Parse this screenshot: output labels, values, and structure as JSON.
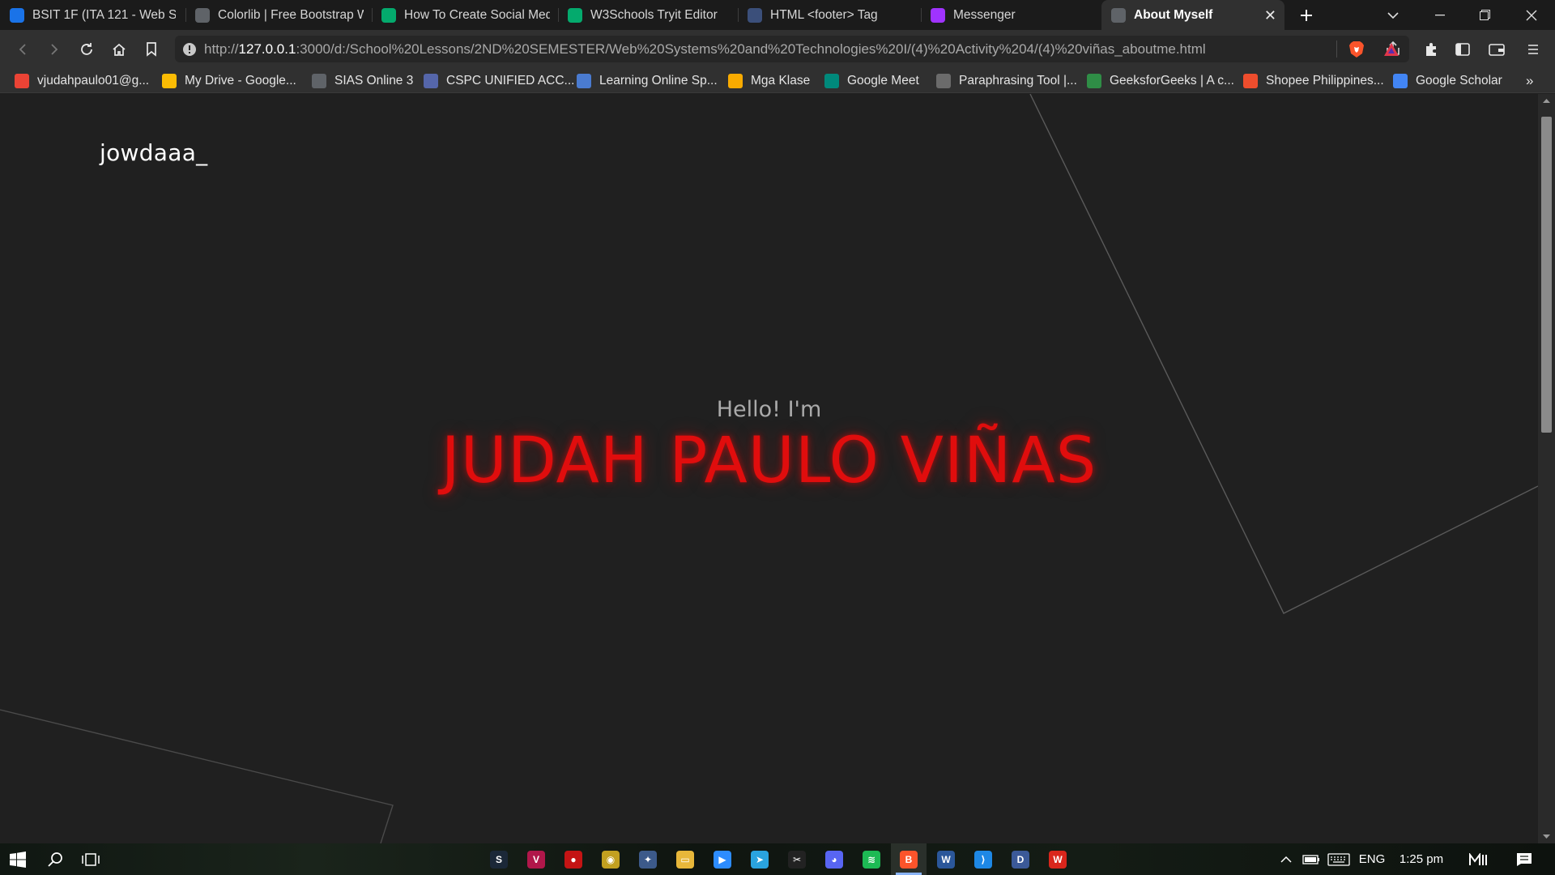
{
  "browser": {
    "tabs": [
      {
        "title": "BSIT 1F (ITA 121 - Web Syst",
        "icon": "classroom-icon",
        "color": "#1a73e8"
      },
      {
        "title": "Colorlib | Free Bootstrap W",
        "icon": "globe-icon",
        "color": "#5f6368"
      },
      {
        "title": "How To Create Social Medi",
        "icon": "w3schools-icon",
        "color": "#04aa6d"
      },
      {
        "title": "W3Schools Tryit Editor",
        "icon": "w3schools-icon",
        "color": "#04aa6d"
      },
      {
        "title": "HTML <footer> Tag",
        "icon": "html-icon",
        "color": "#3b4f7a"
      },
      {
        "title": "Messenger",
        "icon": "messenger-icon",
        "color": "#a033ff"
      },
      {
        "title": "About Myself",
        "icon": "globe-icon",
        "color": "#5f6368",
        "active": true
      }
    ],
    "address": {
      "prefix": "http://",
      "host": "127.0.0.1",
      "rest": ":3000/d:/School%20Lessons/2ND%20SEMESTER/Web%20Systems%20and%20Technologies%20I/(4)%20Activity%204/(4)%20viñas_aboutme.html"
    },
    "bookmarks": [
      {
        "label": "vjudahpaulo01@g...",
        "icon": "gmail-icon",
        "color": "#ea4335"
      },
      {
        "label": "My Drive - Google...",
        "icon": "google-drive-icon",
        "color": "#fbbc04"
      },
      {
        "label": "SIAS Online 3",
        "icon": "globe-icon",
        "color": "#5f6368"
      },
      {
        "label": "CSPC UNIFIED ACC...",
        "icon": "school-icon",
        "color": "#5566aa"
      },
      {
        "label": "Learning Online Sp...",
        "icon": "learning-icon",
        "color": "#4a7bd0"
      },
      {
        "label": "Mga Klase",
        "icon": "classroom-icon",
        "color": "#f9ab00"
      },
      {
        "label": "Google Meet",
        "icon": "google-meet-icon",
        "color": "#00897b"
      },
      {
        "label": "Paraphrasing Tool |...",
        "icon": "pen-icon",
        "color": "#6b6b6b"
      },
      {
        "label": "GeeksforGeeks | A c...",
        "icon": "geeksforgeeks-icon",
        "color": "#2f8d46"
      },
      {
        "label": "Shopee Philippines...",
        "icon": "shopee-icon",
        "color": "#ee4d2d"
      },
      {
        "label": "Google Scholar",
        "icon": "google-scholar-icon",
        "color": "#4285f4"
      }
    ],
    "more_bookmarks": "»"
  },
  "page": {
    "logo": "jowdaaa_",
    "greeting": "Hello! I'm",
    "name": "JUDAH PAULO VIÑAS",
    "name_color": "#e00d0d",
    "background_color": "#202020"
  },
  "taskbar": {
    "apps": [
      {
        "name": "steam-icon",
        "color": "#1b2838",
        "glyph": "S"
      },
      {
        "name": "pinterest-like-icon",
        "color": "#b0174a",
        "glyph": "V"
      },
      {
        "name": "red-app-icon",
        "color": "#c41414",
        "glyph": "●"
      },
      {
        "name": "yellow-app-icon",
        "color": "#c2a020",
        "glyph": "◉"
      },
      {
        "name": "game-app-icon",
        "color": "#3c5a8a",
        "glyph": "✦"
      },
      {
        "name": "file-explorer-icon",
        "color": "#e8b73a",
        "glyph": "▭"
      },
      {
        "name": "zoom-icon",
        "color": "#2d8cff",
        "glyph": "▶"
      },
      {
        "name": "telegram-icon",
        "color": "#2aa3df",
        "glyph": "➤"
      },
      {
        "name": "capcut-icon",
        "color": "#222222",
        "glyph": "✂"
      },
      {
        "name": "discord-icon",
        "color": "#5865f2",
        "glyph": "◕"
      },
      {
        "name": "spotify-icon",
        "color": "#1db954",
        "glyph": "≋"
      },
      {
        "name": "brave-icon",
        "color": "#fb542b",
        "glyph": "B",
        "running": true,
        "focused": true
      },
      {
        "name": "word-app-icon",
        "color": "#2b579a",
        "glyph": "W"
      },
      {
        "name": "vscode-icon",
        "color": "#1e88e5",
        "glyph": "⟩"
      },
      {
        "name": "dev-app-icon",
        "color": "#3b5998",
        "glyph": "D"
      },
      {
        "name": "wps-office-icon",
        "color": "#d9261c",
        "glyph": "W"
      }
    ],
    "language": "ENG",
    "time": "1:25 pm"
  }
}
